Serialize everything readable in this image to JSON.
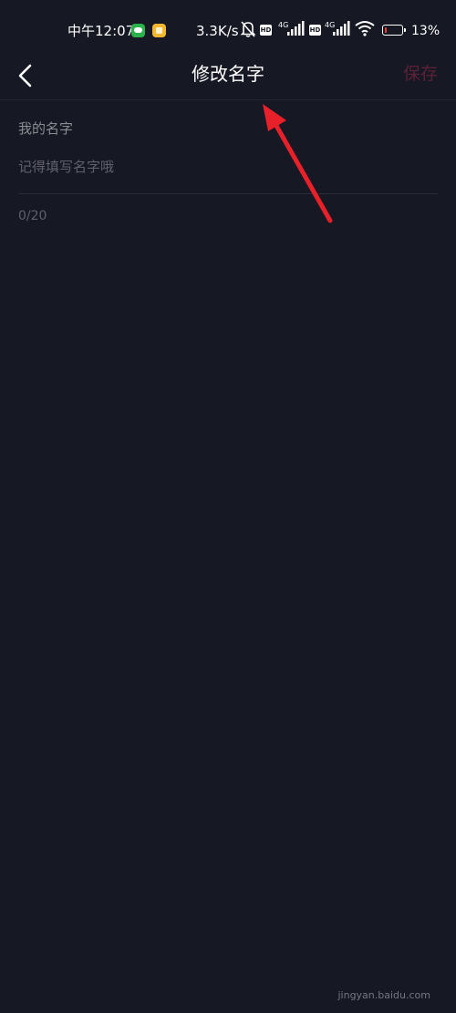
{
  "status_bar": {
    "time": "中午12:07",
    "network_speed": "3.3K/s",
    "hd_label": "HD",
    "network_type": "4G",
    "battery_percent": "13%",
    "battery_level": 0.13,
    "battery_color": "#ff3b30"
  },
  "nav": {
    "title": "修改名字",
    "save_label": "保存",
    "back_icon": "chevron-left-icon",
    "save_color": "#5c2136"
  },
  "form": {
    "field_label": "我的名字",
    "input_value": "",
    "input_placeholder": "记得填写名字哦",
    "char_count": "0/20"
  },
  "watermark": "jingyan.baidu.com",
  "colors": {
    "background": "#161823",
    "annotation_arrow": "#e8202a"
  }
}
